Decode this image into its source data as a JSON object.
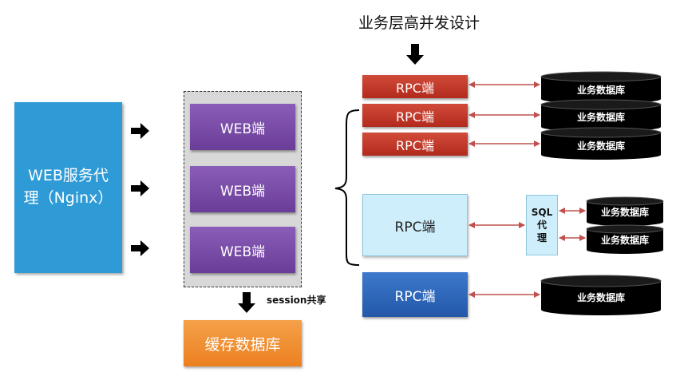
{
  "title": "业务层高并发设计",
  "proxy": {
    "line1": "WEB服务代",
    "line2": "理（Nginx）"
  },
  "web_nodes": [
    "WEB端",
    "WEB端",
    "WEB端"
  ],
  "rpc_nodes": [
    "RPC端",
    "RPC端",
    "RPC端",
    "RPC端",
    "RPC端"
  ],
  "sql_proxy": {
    "line1": "SQL",
    "line2": "代",
    "line3": "理"
  },
  "databases": [
    "业务数据库",
    "业务数据库",
    "业务数据库",
    "业务数据库",
    "业务数据库",
    "业务数据库"
  ],
  "session_label": "session共享",
  "cache_db": "缓存数据库",
  "colors": {
    "proxy": "#2f9bd6",
    "web": "#7a4db0",
    "rpc_red": "#c23a2a",
    "rpc_light": "#cdeefa",
    "rpc_blue": "#2f68bd",
    "cache": "#f08a30",
    "db": "#000000",
    "link": "#c0504d"
  }
}
